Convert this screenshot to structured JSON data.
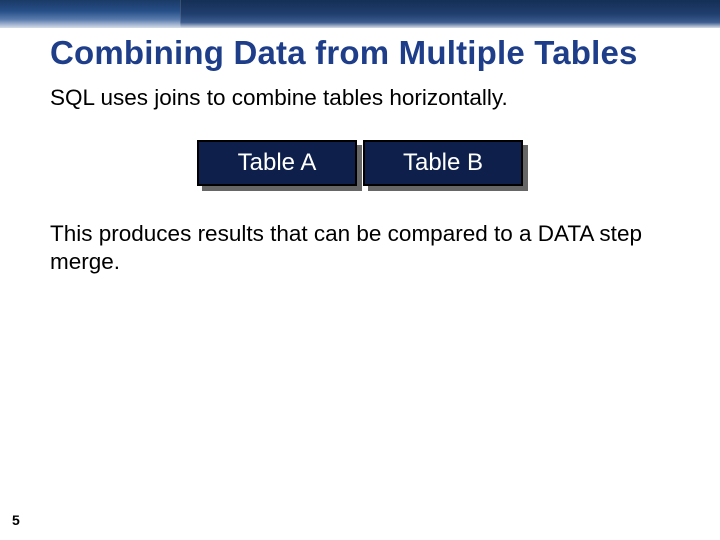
{
  "header": {},
  "slide": {
    "title": "Combining Data from Multiple Tables",
    "subtitle": "SQL uses joins to combine tables horizontally.",
    "tables": {
      "a": "Table A",
      "b": "Table B"
    },
    "body": "This produces results that can be compared to a DATA step merge."
  },
  "page_number": "5"
}
